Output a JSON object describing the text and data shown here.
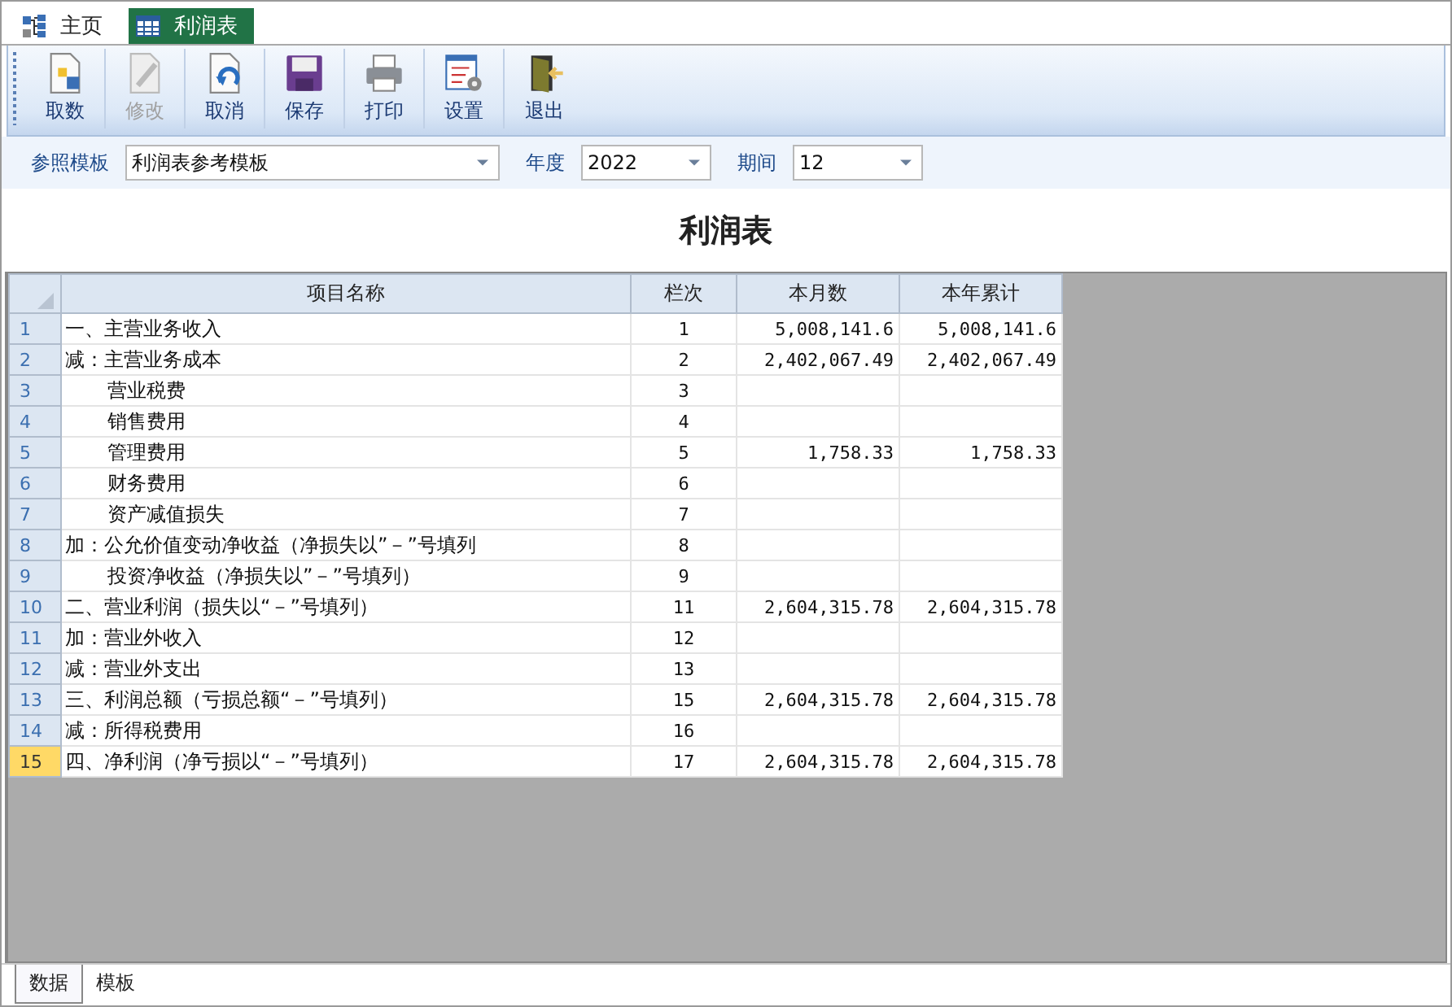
{
  "tabs": [
    {
      "label": "主页",
      "selected": false
    },
    {
      "label": "利润表",
      "selected": true
    }
  ],
  "toolbar": [
    {
      "label": "取数",
      "disabled": false
    },
    {
      "label": "修改",
      "disabled": true
    },
    {
      "label": "取消",
      "disabled": false
    },
    {
      "label": "保存",
      "disabled": false
    },
    {
      "label": "打印",
      "disabled": false
    },
    {
      "label": "设置",
      "disabled": false
    },
    {
      "label": "退出",
      "disabled": false
    }
  ],
  "filters": [
    {
      "label": "参照模板",
      "value": "利润表参考模板"
    },
    {
      "label": "年度",
      "value": "2022"
    },
    {
      "label": "期间",
      "value": "12"
    }
  ],
  "report_title": "利润表",
  "table": {
    "columns": [
      "项目名称",
      "栏次",
      "本月数",
      "本年累计"
    ],
    "rows": [
      {
        "no": "1",
        "name": "一、主营业务收入",
        "line": "1",
        "month": "5,008,141.6",
        "year": "5,008,141.6",
        "selected": false
      },
      {
        "no": "2",
        "name": "减：主营业务成本",
        "line": "2",
        "month": "2,402,067.49",
        "year": "2,402,067.49",
        "selected": false,
        "children": [
          {
            "no": "3",
            "name": "营业税费",
            "line": "3",
            "selected": false
          },
          {
            "no": "4",
            "name": "销售费用",
            "line": "4",
            "selected": false
          },
          {
            "no": "5",
            "name": "管理费用",
            "line": "5",
            "month": "1,758.33",
            "year": "1,758.33",
            "selected": false
          },
          {
            "no": "6",
            "name": "财务费用",
            "line": "6",
            "selected": false
          },
          {
            "no": "7",
            "name": "资产减值损失",
            "line": "7",
            "selected": false
          }
        ]
      },
      {
        "no": "8",
        "name": "加：公允价值变动净收益（净损失以”－”号填列",
        "line": "8",
        "selected": false,
        "children": [
          {
            "no": "9",
            "name": "投资净收益（净损失以”－”号填列）",
            "line": "9",
            "selected": false
          }
        ]
      },
      {
        "no": "10",
        "name": "二、营业利润（损失以“－”号填列）",
        "line": "11",
        "month": "2,604,315.78",
        "year": "2,604,315.78",
        "selected": false
      },
      {
        "no": "11",
        "name": "加：营业外收入",
        "line": "12",
        "selected": false
      },
      {
        "no": "12",
        "name": "减：营业外支出",
        "line": "13",
        "selected": false
      },
      {
        "no": "13",
        "name": "三、利润总额（亏损总额“－”号填列）",
        "line": "15",
        "month": "2,604,315.78",
        "year": "2,604,315.78",
        "selected": false
      },
      {
        "no": "14",
        "name": "减：所得税费用",
        "line": "16",
        "selected": false
      },
      {
        "no": "15",
        "name": "四、净利润（净亏损以“－”号填列）",
        "line": "17",
        "month": "2,604,315.78",
        "year": "2,604,315.78",
        "selected": true
      }
    ]
  },
  "bottom_tabs": [
    {
      "label": "数据",
      "selected": true
    },
    {
      "label": "模板",
      "selected": false
    }
  ]
}
